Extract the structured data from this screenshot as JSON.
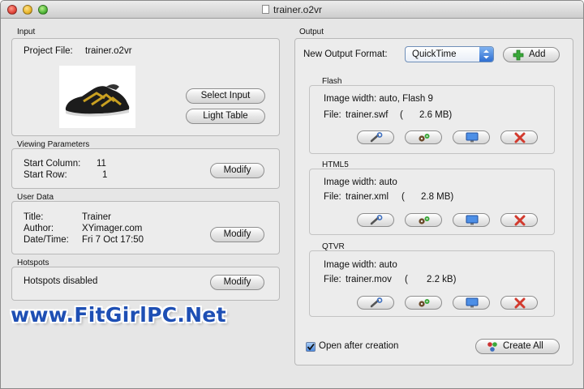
{
  "window": {
    "title": "trainer.o2vr"
  },
  "input": {
    "section_label": "Input",
    "project_file_label": "Project File:",
    "project_file_value": "trainer.o2vr",
    "select_input_label": "Select Input",
    "light_table_label": "Light Table"
  },
  "viewing": {
    "section_label": "Viewing Parameters",
    "start_column_label": "Start Column:",
    "start_column_value": "11",
    "start_row_label": "Start Row:",
    "start_row_value": "1",
    "modify_label": "Modify"
  },
  "user_data": {
    "section_label": "User Data",
    "title_label": "Title:",
    "title_value": "Trainer",
    "author_label": "Author:",
    "author_value": "XYimager.com",
    "datetime_label": "Date/Time:",
    "datetime_value": "Fri 7 Oct 17:50",
    "modify_label": "Modify"
  },
  "hotspots": {
    "section_label": "Hotspots",
    "status": "Hotspots disabled",
    "modify_label": "Modify"
  },
  "output": {
    "section_label": "Output",
    "format_label": "New Output Format:",
    "format_value": "QuickTime",
    "add_label": "Add",
    "formats": [
      {
        "name": "Flash",
        "line1": "Image width: auto, Flash 9",
        "file_label": "File:",
        "file_name": "trainer.swf",
        "paren": "(",
        "file_size": "2.6 MB)"
      },
      {
        "name": "HTML5",
        "line1": "Image width: auto",
        "file_label": "File:",
        "file_name": "trainer.xml",
        "paren": "(",
        "file_size": "2.8 MB)"
      },
      {
        "name": "QTVR",
        "line1": "Image width: auto",
        "file_label": "File:",
        "file_name": "trainer.mov",
        "paren": "(",
        "file_size": "2.2 kB)"
      }
    ],
    "open_after_creation_label": "Open after creation",
    "open_after_creation_checked": true,
    "create_all_label": "Create All"
  },
  "watermark": {
    "text": "www.FitGirlPC.Net"
  },
  "colors": {
    "accent_blue": "#2f6fd1",
    "watermark_blue": "#1e4fb4",
    "delete_red": "#d23a2e",
    "add_green": "#3aa83a"
  }
}
